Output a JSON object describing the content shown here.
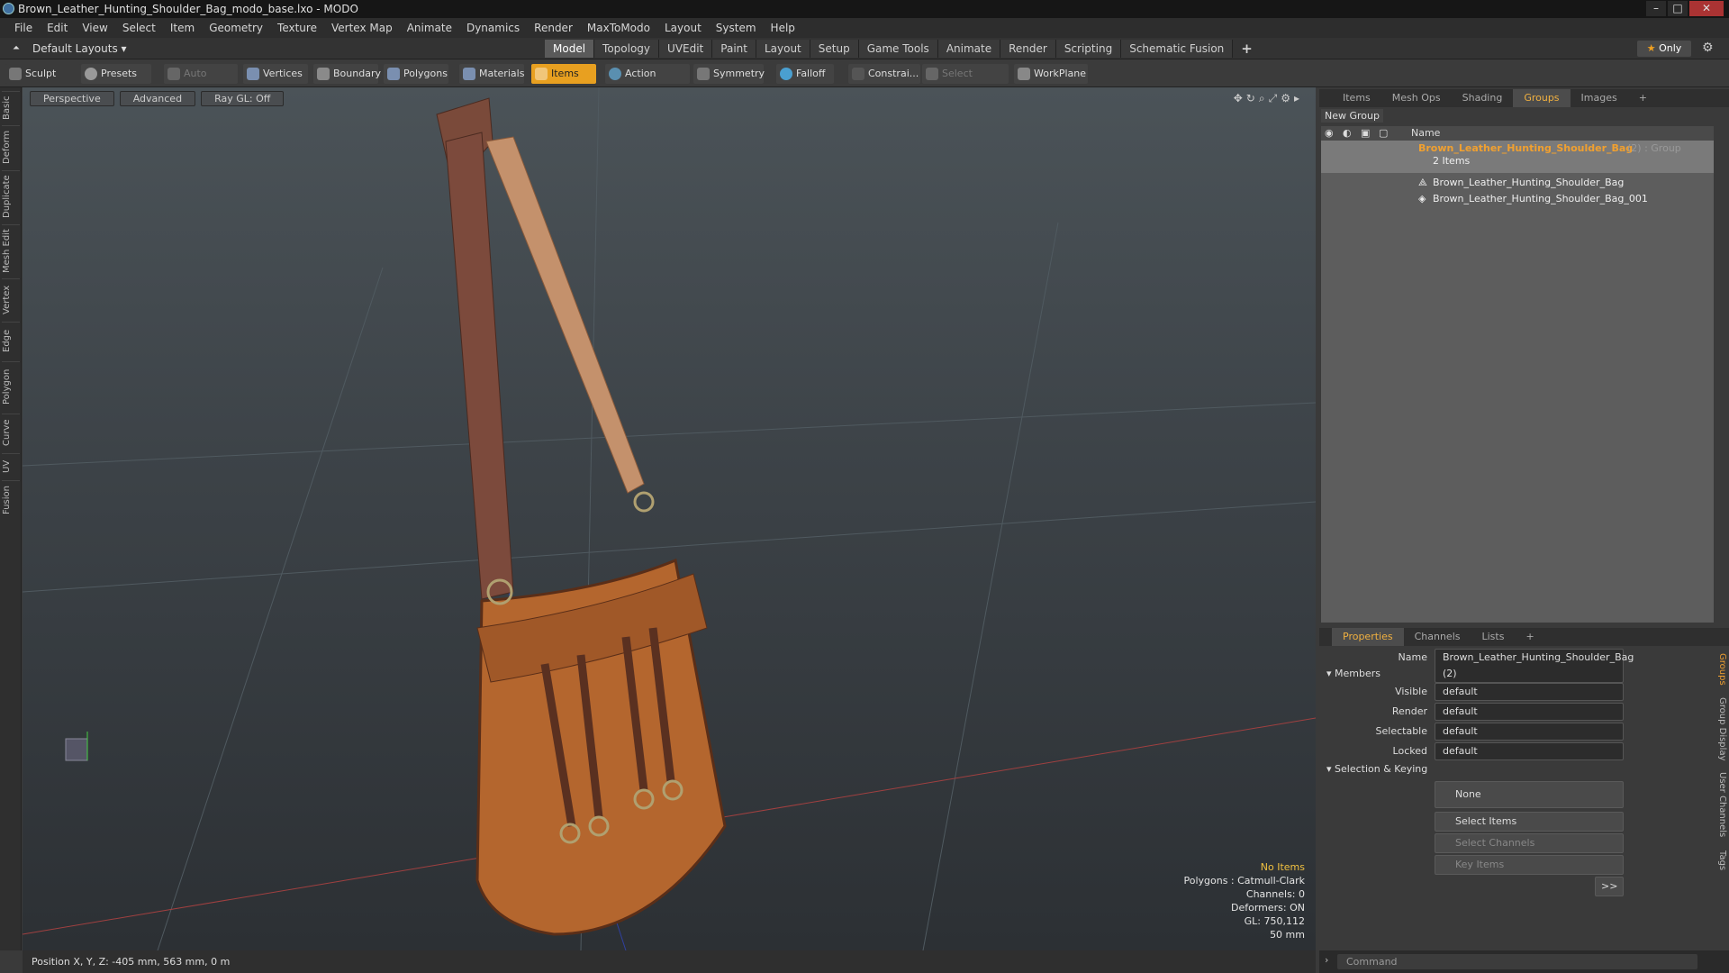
{
  "window": {
    "title": "Brown_Leather_Hunting_Shoulder_Bag_modo_base.lxo - MODO"
  },
  "menu": [
    "File",
    "Edit",
    "View",
    "Select",
    "Item",
    "Geometry",
    "Texture",
    "Vertex Map",
    "Animate",
    "Dynamics",
    "Render",
    "MaxToModo",
    "Layout",
    "System",
    "Help"
  ],
  "layouts": {
    "label": "Default Layouts"
  },
  "tabs": [
    "Model",
    "Topology",
    "UVEdit",
    "Paint",
    "Layout",
    "Setup",
    "Game Tools",
    "Animate",
    "Render",
    "Scripting",
    "Schematic Fusion"
  ],
  "tabs_active": "Model",
  "only_label": "Only",
  "toolbar": {
    "sculpt": "Sculpt",
    "presets": "Presets",
    "auto_select": "Auto Select",
    "vertices": "Vertices",
    "boundary": "Boundary",
    "polygons": "Polygons",
    "materials": "Materials",
    "items": "Items",
    "action_center": "Action Center",
    "symmetry": "Symmetry",
    "falloff": "Falloff",
    "constraints": "Constrai...",
    "select_through": "Select Through",
    "workplane": "WorkPlane"
  },
  "left_tabs": [
    "Basic",
    "Deform",
    "Duplicate",
    "Mesh Edit",
    "Vertex",
    "Edge",
    "Polygon",
    "Curve",
    "UV",
    "Fusion"
  ],
  "viewport": {
    "perspective": "Perspective",
    "advanced": "Advanced",
    "raygl": "Ray GL: Off",
    "info": {
      "no_items": "No Items",
      "polygons": "Polygons : Catmull-Clark",
      "channels": "Channels: 0",
      "deformers": "Deformers: ON",
      "gl": "GL: 750,112",
      "focal": "50 mm"
    }
  },
  "status": {
    "position": "Position X, Y, Z:  -405 mm, 563 mm, 0 m"
  },
  "right_tabs": [
    "Items",
    "Mesh Ops",
    "Shading",
    "Groups",
    "Images"
  ],
  "right_tabs_active": "Groups",
  "groups": {
    "new_group": "New Group",
    "col_name": "Name",
    "group_name": "Brown_Leather_Hunting_Shoulder_Bag",
    "group_suffix": "(2) : Group",
    "group_count": "2 Items",
    "children": [
      "Brown_Leather_Hunting_Shoulder_Bag",
      "Brown_Leather_Hunting_Shoulder_Bag_001"
    ]
  },
  "prop_tabs": [
    "Properties",
    "Channels",
    "Lists"
  ],
  "properties": {
    "name_label": "Name",
    "name_value": "Brown_Leather_Hunting_Shoulder_Bag (2)",
    "members": "Members",
    "visible_label": "Visible",
    "visible": "default",
    "render_label": "Render",
    "render": "default",
    "selectable_label": "Selectable",
    "selectable": "default",
    "locked_label": "Locked",
    "locked": "default",
    "sel_keying": "Selection & Keying",
    "none": "None",
    "select_items": "Select Items",
    "select_channels": "Select Channels",
    "key_items": "Key Items",
    "more": ">>"
  },
  "side_vtabs": [
    "Groups",
    "Group Display",
    "User Channels",
    "Tags"
  ],
  "command": {
    "placeholder": "Command"
  },
  "colors": {
    "accent": "#e8a020",
    "group_name": "#f0a030"
  }
}
